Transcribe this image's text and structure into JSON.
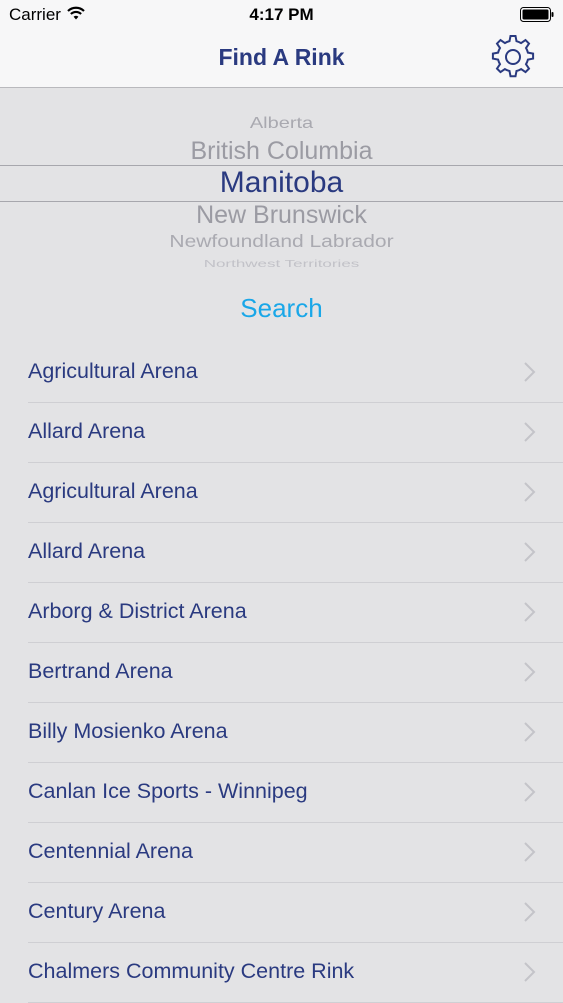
{
  "status_bar": {
    "carrier": "Carrier",
    "time": "4:17 PM",
    "icons": [
      "wifi-icon",
      "battery-icon"
    ]
  },
  "nav": {
    "title": "Find A Rink",
    "settings_icon": "gear-icon"
  },
  "picker": {
    "options": [
      "Alberta",
      "British Columbia",
      "Manitoba",
      "New Brunswick",
      "Newfoundland Labrador",
      "Northwest Territories"
    ],
    "selected": "Manitoba"
  },
  "search": {
    "label": "Search"
  },
  "rinks": [
    "Agricultural Arena",
    "Allard Arena",
    "Agricultural Arena",
    "Allard Arena",
    "Arborg & District Arena",
    "Bertrand Arena",
    "Billy Mosienko Arena",
    "Canlan Ice Sports - Winnipeg",
    "Centennial Arena",
    "Century Arena",
    "Chalmers Community Centre Rink"
  ],
  "colors": {
    "accent_navy": "#2a3a80",
    "search_blue": "#1aa7e8",
    "background": "#e3e3e5"
  }
}
